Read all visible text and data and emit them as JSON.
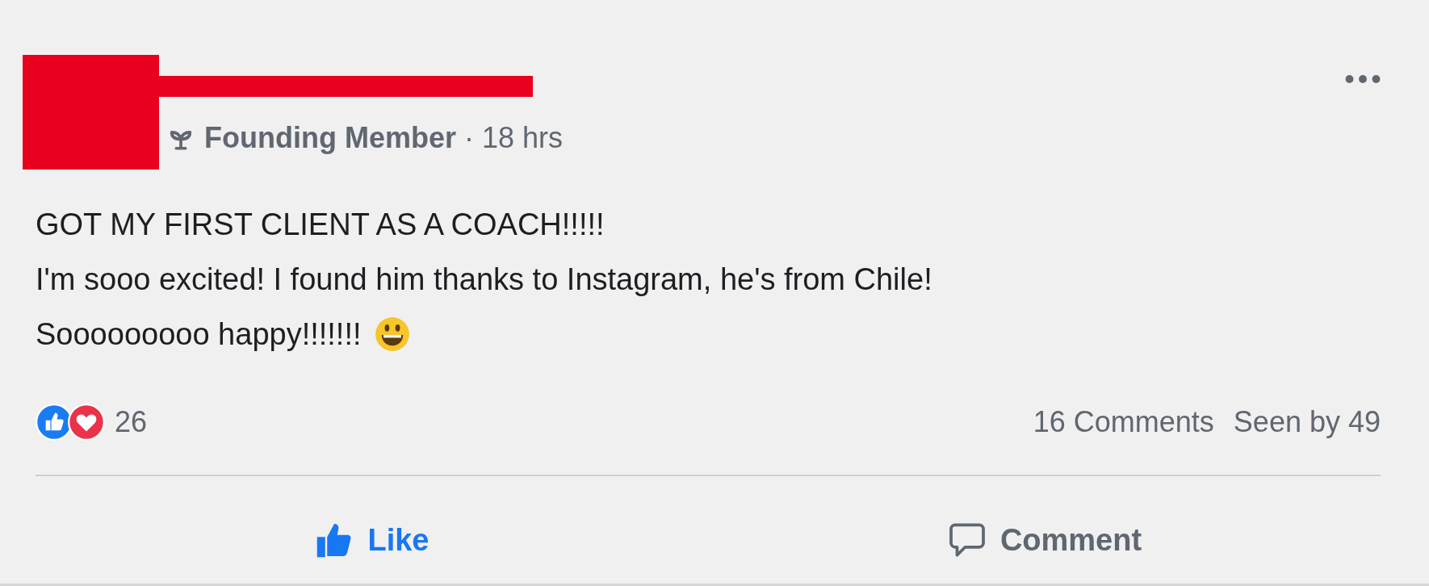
{
  "post": {
    "author_badge": "Founding Member",
    "separator": "·",
    "time": "18 hrs",
    "lines": [
      "GOT MY FIRST CLIENT AS A COACH!!!!!",
      "I'm sooo excited! I found him thanks to Instagram, he's from Chile!",
      "Sooooooooo happy!!!!!!!"
    ],
    "reaction_count": "26",
    "comments": "16 Comments",
    "seen": "Seen by 49"
  },
  "actions": [
    {
      "kind": "like",
      "label": "Like",
      "selected": true
    },
    {
      "kind": "comment",
      "label": "Comment",
      "selected": false
    }
  ]
}
